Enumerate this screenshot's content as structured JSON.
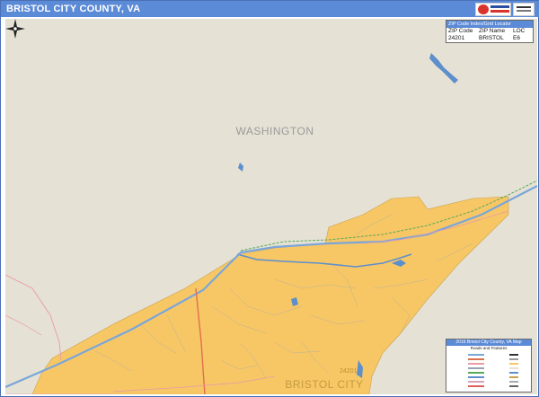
{
  "header": {
    "title": "BRISTOL CITY COUNTY, VA"
  },
  "map": {
    "labels": {
      "county_neighbor": "WASHINGTON",
      "city": "BRISTOL CITY",
      "zip_on_map": "24201"
    },
    "colors": {
      "land": "#e6e1d5",
      "city_fill": "#f7c766",
      "water": "#5d8fcc",
      "highway": "#7aa6d9",
      "major_road": "#e0704d",
      "railroad": "#5aa95a"
    }
  },
  "zip_table": {
    "title": "ZIP Code Index/Grid Locator",
    "headers": [
      "ZIP Code",
      "ZIP Name",
      "LOC"
    ],
    "rows": [
      [
        "24201",
        "BRISTOL",
        "E6"
      ]
    ]
  },
  "legend": {
    "title": "2016 Bristol City County, VA Map",
    "subtitle": "Roads and Features"
  },
  "icons": {
    "compass": "compass-rose-icon",
    "logo": "publisher-logo-icon"
  }
}
